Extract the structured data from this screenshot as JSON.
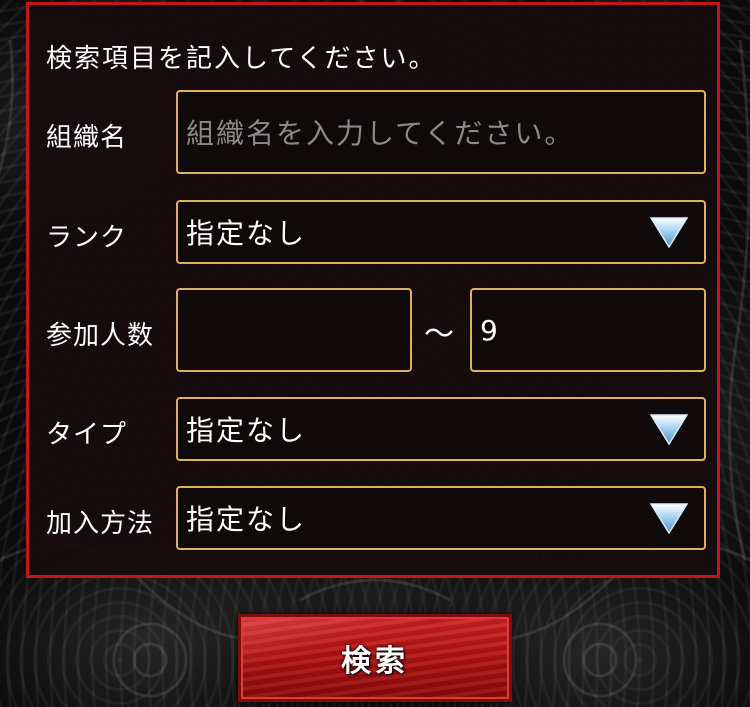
{
  "form": {
    "instruction": "検索項目を記入してください。",
    "org_name_label": "組織名",
    "org_name_placeholder": "組織名を入力してください。",
    "rank_label": "ランク",
    "rank_value": "指定なし",
    "members_label": "参加人数",
    "members_min": "",
    "members_separator": "～",
    "members_max": "9",
    "type_label": "タイプ",
    "type_value": "指定なし",
    "join_label": "加入方法",
    "join_value": "指定なし",
    "search_label": "検索"
  },
  "colors": {
    "panel_border": "#c41616",
    "field_border": "#dcb25a",
    "button_red": "#c41a1a",
    "dropdown_arrow": "#6ea8d8"
  },
  "icons": {
    "dropdown": "triangle-down-icon"
  }
}
